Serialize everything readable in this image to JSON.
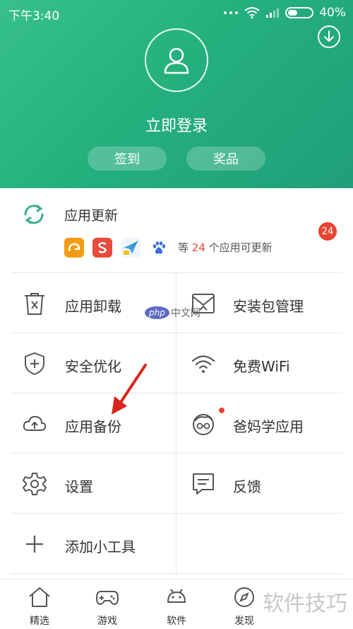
{
  "status_bar": {
    "time": "下午3:40",
    "battery": "40%"
  },
  "header": {
    "login_text": "立即登录",
    "sign_in_label": "签到",
    "prize_label": "奖品"
  },
  "update": {
    "title": "应用更新",
    "count_prefix": "等",
    "count": "24",
    "count_suffix": "个应用可更新",
    "badge": "24",
    "app_icons": [
      {
        "icon": "uc-browser-icon",
        "color": "#f39c12"
      },
      {
        "icon": "sogou-icon",
        "color": "#e74c3c"
      },
      {
        "icon": "paper-plane-icon",
        "color": "#4aa3df"
      },
      {
        "icon": "baidu-icon",
        "color": "#3b6fd8"
      }
    ]
  },
  "grid": [
    {
      "left": {
        "label": "应用卸载",
        "icon": "trash-icon"
      },
      "right": {
        "label": "安装包管理",
        "icon": "package-icon"
      }
    },
    {
      "left": {
        "label": "安全优化",
        "icon": "shield-icon"
      },
      "right": {
        "label": "免费WiFi",
        "icon": "wifi-icon"
      }
    },
    {
      "left": {
        "label": "应用备份",
        "icon": "cloud-upload-icon"
      },
      "right": {
        "label": "爸妈学应用",
        "icon": "face-icon"
      }
    },
    {
      "left": {
        "label": "设置",
        "icon": "gear-icon"
      },
      "right": {
        "label": "反馈",
        "icon": "chat-icon"
      }
    },
    {
      "left": {
        "label": "添加小工具",
        "icon": "plus-icon"
      }
    }
  ],
  "bottom_nav": [
    {
      "label": "精选",
      "icon": "home-icon"
    },
    {
      "label": "游戏",
      "icon": "gamepad-icon"
    },
    {
      "label": "软件",
      "icon": "android-icon"
    },
    {
      "label": "发现",
      "icon": "discover-icon"
    }
  ],
  "watermarks": {
    "php_badge": "php",
    "php_text": "中文网",
    "tips": "软件技巧"
  },
  "colors": {
    "header_green": "#25b07e",
    "badge_red": "#e8442f",
    "arrow_red": "#d9261c"
  }
}
